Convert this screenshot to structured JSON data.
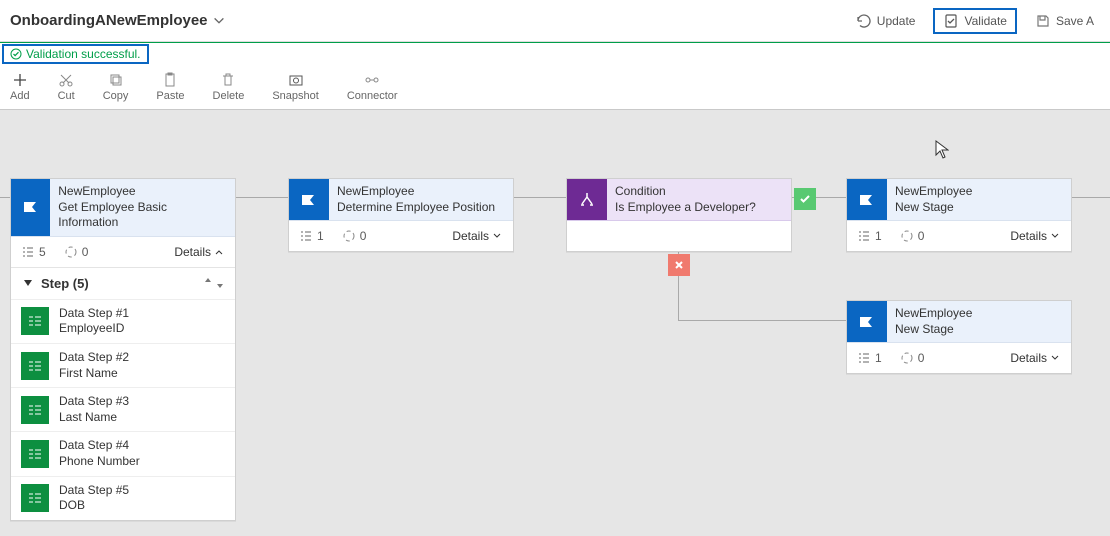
{
  "header": {
    "title": "OnboardingANewEmployee",
    "actions": {
      "update": "Update",
      "validate": "Validate",
      "saveas": "Save A"
    }
  },
  "status": {
    "message": "Validation successful."
  },
  "toolbar": {
    "add": "Add",
    "cut": "Cut",
    "copy": "Copy",
    "paste": "Paste",
    "delete": "Delete",
    "snapshot": "Snapshot",
    "connector": "Connector"
  },
  "detailsLabel": "Details",
  "stages": {
    "s1": {
      "name": "NewEmployee",
      "desc": "Get Employee Basic Information",
      "steps": "5",
      "refs": "0",
      "stepHeader": "Step (5)",
      "stepItems": [
        {
          "title": "Data Step #1",
          "sub": "EmployeeID"
        },
        {
          "title": "Data Step #2",
          "sub": "First Name"
        },
        {
          "title": "Data Step #3",
          "sub": "Last Name"
        },
        {
          "title": "Data Step #4",
          "sub": "Phone Number"
        },
        {
          "title": "Data Step #5",
          "sub": "DOB"
        }
      ]
    },
    "s2": {
      "name": "NewEmployee",
      "desc": "Determine Employee Position",
      "steps": "1",
      "refs": "0"
    },
    "cond": {
      "name": "Condition",
      "desc": "Is Employee a Developer?"
    },
    "s4": {
      "name": "NewEmployee",
      "desc": "New Stage",
      "steps": "1",
      "refs": "0"
    },
    "s5": {
      "name": "NewEmployee",
      "desc": "New Stage",
      "steps": "1",
      "refs": "0"
    }
  }
}
